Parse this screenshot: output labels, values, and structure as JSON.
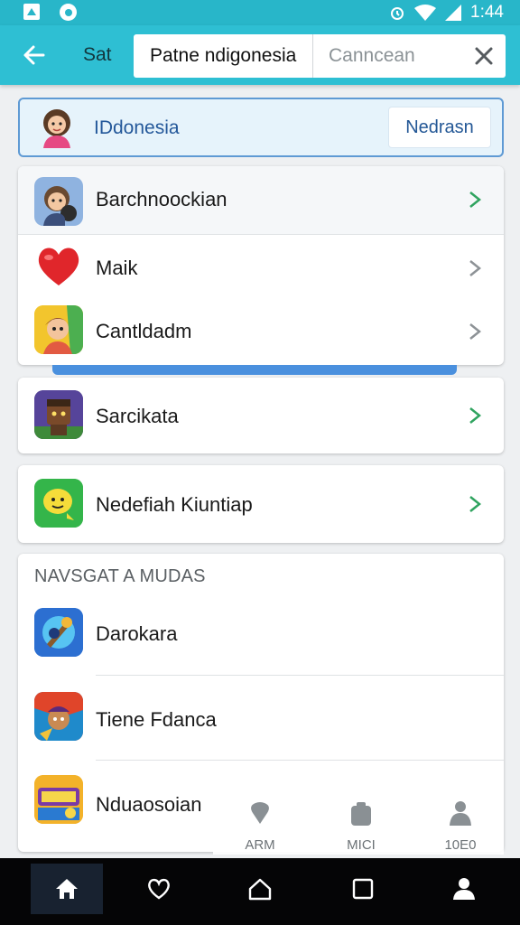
{
  "status_bar": {
    "time": "1:44",
    "icons": [
      "gallery-icon",
      "sync-icon",
      "alarm-icon",
      "wifi-icon",
      "signal-icon"
    ]
  },
  "app_bar": {
    "back_icon": "arrow-left-icon",
    "label": "Sat",
    "search_query": "Patne ndigonesia",
    "search_secondary": "Canncean",
    "clear_icon": "close-icon"
  },
  "selected": {
    "label": "IDdonesia",
    "button": "Nedrasn",
    "accent": "#5f9ad4"
  },
  "list_group_1": [
    {
      "label": "Barchnoockian",
      "icon": "boy-avatar-icon",
      "chevron_color": "#2fa35f"
    },
    {
      "label": "Maik",
      "icon": "heart-icon",
      "chevron_color": "#8d9296"
    },
    {
      "label": "Cantldadm",
      "icon": "cartoon-kid-icon",
      "chevron_color": "#8d9296"
    }
  ],
  "list_group_2": [
    {
      "label": "Sarcikata",
      "icon": "game-character-icon",
      "chevron_color": "#2fa35f"
    }
  ],
  "list_group_3": [
    {
      "label": "Nedefiah Kiuntiap",
      "icon": "smiley-face-icon",
      "chevron_color": "#2fa35f"
    }
  ],
  "section": {
    "title": "NAVSGAT A MUDAS",
    "items": [
      {
        "label": "Darokara",
        "icon": "fantasy-game-icon"
      },
      {
        "label": "Tiene Fdanca",
        "icon": "fighter-game-icon"
      },
      {
        "label": "Nduaosoian",
        "icon": "game-logo-icon"
      }
    ]
  },
  "tabs": [
    {
      "label": "ARM",
      "icon": "chat-bubble-icon"
    },
    {
      "label": "MICI",
      "icon": "bag-icon"
    },
    {
      "label": "10E0",
      "icon": "person-icon"
    }
  ],
  "nav": [
    {
      "name": "home",
      "icon": "home-icon"
    },
    {
      "name": "favorites",
      "icon": "heart-outline-icon"
    },
    {
      "name": "house",
      "icon": "house-outline-icon"
    },
    {
      "name": "overview",
      "icon": "square-icon"
    },
    {
      "name": "profile",
      "icon": "profile-icon"
    }
  ]
}
